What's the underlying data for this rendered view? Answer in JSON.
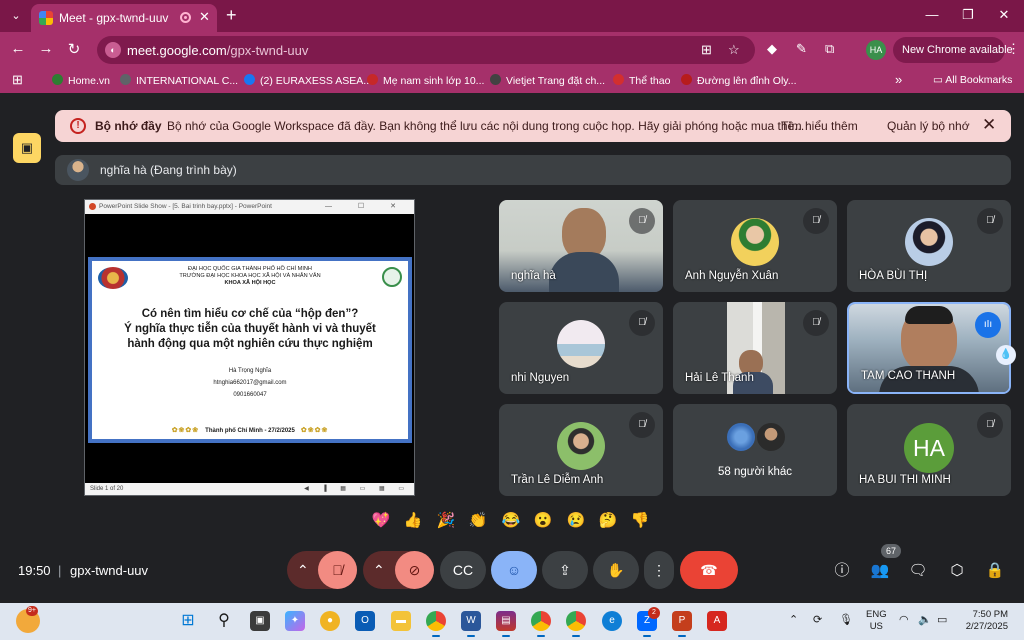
{
  "browser": {
    "tab_title": "Meet - gpx-twnd-uuv",
    "url_host": "meet.google.com",
    "url_path": "/gpx-twnd-uuv",
    "profile_initials": "HA",
    "new_chrome_label": "New Chrome available"
  },
  "bookmarks": [
    {
      "label": "Home.vn",
      "color": "#2e7d32"
    },
    {
      "label": "INTERNATIONAL C...",
      "color": "#5f6368"
    },
    {
      "label": "(2) EURAXESS ASEA...",
      "color": "#1877f2"
    },
    {
      "label": "Mẹ nam sinh lớp 10...",
      "color": "#c62828"
    },
    {
      "label": "Vietjet Trang đặt ch...",
      "color": "#424242"
    },
    {
      "label": "Thể thao",
      "color": "#d32f2f"
    },
    {
      "label": "Đường lên đỉnh Oly...",
      "color": "#b71c1c"
    }
  ],
  "all_bookmarks_label": "All Bookmarks",
  "banner": {
    "title": "Bộ nhớ đầy",
    "text": "Bộ nhớ của Google Workspace đã đầy. Bạn không thể lưu các nội dung trong cuộc họp. Hãy giải phóng hoặc mua thê...",
    "learn_more": "Tìm hiểu thêm",
    "manage": "Quản lý bộ nhớ"
  },
  "presenter": {
    "label": "nghĩa hà (Đang trình bày)"
  },
  "slide": {
    "window_title": "PowerPoint Slide Show - [5. Bai trinh bay.pptx] - PowerPoint",
    "university_line1": "ĐẠI HỌC QUỐC GIA THÀNH PHỐ HỒ CHÍ MINH",
    "university_line2": "TRƯỜNG ĐẠI HỌC KHOA HỌC XÃ HỘI VÀ NHÂN VĂN",
    "department": "KHOA XÃ HỘI HỌC",
    "title_line1": "Có nên tìm hiểu cơ chế của “hộp đen”?",
    "title_line2": "Ý nghĩa thực tiễn của thuyết hành vi và thuyết",
    "title_line3": "hành động qua một nghiên cứu thực nghiệm",
    "author": "Hà Trọng Nghĩa",
    "email": "htnghia662017@gmail.com",
    "phone": "0901660047",
    "footer": "Thành phố Chí Minh - 27/2/2025",
    "slide_counter": "Slide 1 of 20"
  },
  "participants": [
    {
      "name": "nghĩa hà",
      "type": "video",
      "muted": true
    },
    {
      "name": "Anh Nguyễn Xuân",
      "type": "avatar",
      "muted": true
    },
    {
      "name": "HÒA BÙI THỊ",
      "type": "avatar",
      "muted": true
    },
    {
      "name": "nhi Nguyen",
      "type": "avatar",
      "muted": true
    },
    {
      "name": "Hải Lê Thanh",
      "type": "video",
      "muted": true
    },
    {
      "name": "TAM CAO THANH",
      "type": "video",
      "muted": false,
      "speaking": true
    },
    {
      "name": "Trần Lê Diễm Anh",
      "type": "avatar",
      "muted": true
    },
    {
      "name": "58 người khác",
      "type": "others"
    },
    {
      "name": "HA BUI THI MINH",
      "type": "initials",
      "initials": "HA",
      "muted": true
    }
  ],
  "reactions": [
    "💖",
    "👍",
    "🎉",
    "👏",
    "😂",
    "😮",
    "😢",
    "🤔",
    "👎"
  ],
  "meeting": {
    "time": "19:50",
    "code": "gpx-twnd-uuv",
    "people_count": "67"
  },
  "taskbar": {
    "weather_badge": "9+",
    "zalo_badge": "2",
    "lang_line1": "ENG",
    "lang_line2": "US",
    "time": "7:50 PM",
    "date": "2/27/2025"
  }
}
